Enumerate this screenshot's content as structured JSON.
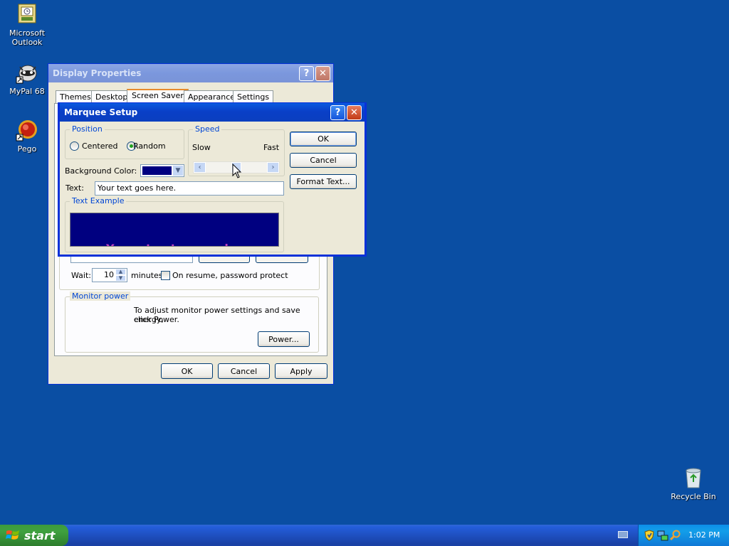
{
  "desktop": {
    "icons": [
      {
        "label": "Microsoft Outlook",
        "line1": "Microsoft",
        "line2": "Outlook",
        "icon": "outlook-icon"
      },
      {
        "label": "MyPal 68",
        "icon": "mypal-icon"
      },
      {
        "label": "Pego",
        "icon": "pego-icon"
      },
      {
        "label": "Recycle Bin",
        "icon": "recycle-bin-icon"
      }
    ]
  },
  "display_properties": {
    "title": "Display Properties",
    "tabs": [
      "Themes",
      "Desktop",
      "Screen Saver",
      "Appearance",
      "Settings"
    ],
    "active_tab": "Screen Saver",
    "wait_label": "Wait:",
    "wait_value": "10",
    "minutes_label": "minutes",
    "resume_label": "On resume, password protect",
    "monitor_power_title": "Monitor power",
    "monitor_power_text_1": "To adjust monitor power settings and save energy,",
    "monitor_power_text_2": "click Power.",
    "power_button": "Power...",
    "ok": "OK",
    "cancel": "Cancel",
    "apply": "Apply"
  },
  "marquee_setup": {
    "title": "Marquee Setup",
    "position_title": "Position",
    "centered": "Centered",
    "random": "Random",
    "selected_position": "Random",
    "speed_title": "Speed",
    "slow": "Slow",
    "fast": "Fast",
    "speed_level": 0.5,
    "background_color_label": "Background Color:",
    "background_color_value": "#000080",
    "text_label": "Text:",
    "text_value": "Your text goes here.",
    "text_example_title": "Text Example",
    "ok": "OK",
    "cancel": "Cancel",
    "format_text": "Format Text..."
  },
  "taskbar": {
    "start_label": "start",
    "clock": "1:02 PM"
  },
  "colors": {
    "desktop": "#0a4ea3",
    "title_active": "#0a3fc7",
    "group_title": "#0046d5",
    "preview_bg": "#000080"
  }
}
